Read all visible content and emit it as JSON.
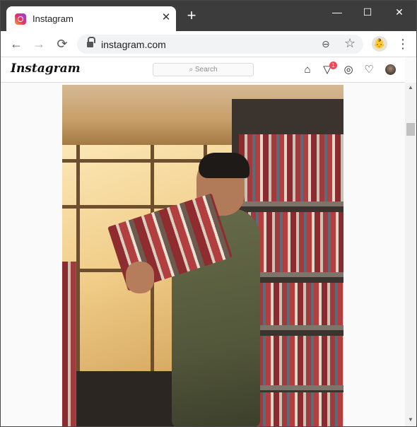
{
  "browser": {
    "tab_title": "Instagram",
    "tab_close": "✕",
    "new_tab": "+",
    "url": "instagram.com",
    "controls": {
      "minimize": "—",
      "maximize": "☐",
      "close": "✕"
    },
    "nav": {
      "back": "←",
      "forward": "→",
      "reload": "⟳"
    },
    "zoom_glyph": "⊖",
    "star_glyph": "☆",
    "menu_glyph": "⋮"
  },
  "instagram": {
    "logo": "Instagram",
    "search_placeholder": "Search",
    "notification_count": "1",
    "icons": [
      "home-icon",
      "direct-icon",
      "explore-icon",
      "activity-heart-icon",
      "profile-avatar"
    ]
  },
  "post": {
    "image_description_icon": "photo-post"
  },
  "scrollbar": {
    "up": "▲",
    "down": "▼"
  }
}
